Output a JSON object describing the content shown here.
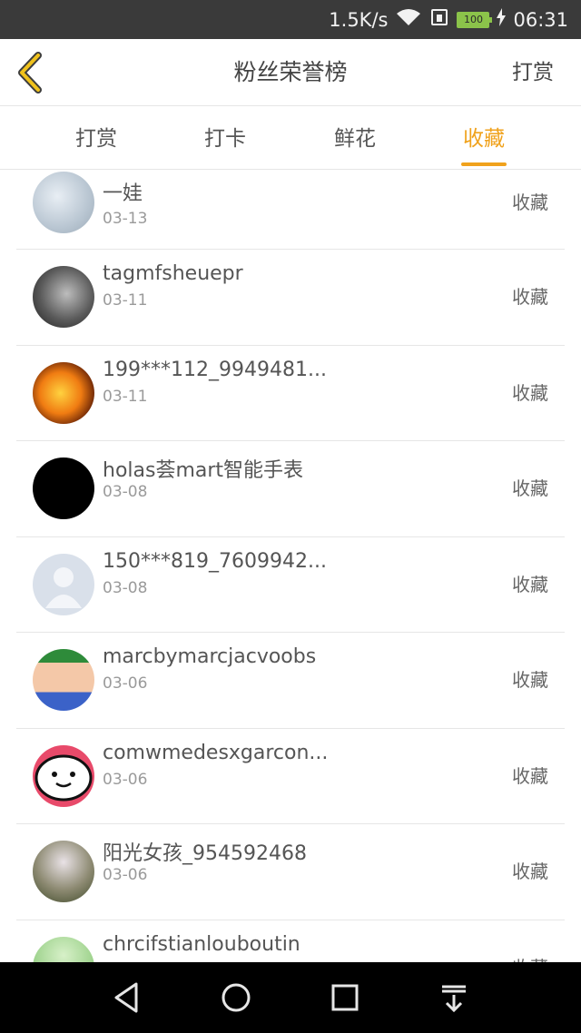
{
  "status": {
    "speed": "1.5K/s",
    "battery": "100",
    "time": "06:31"
  },
  "header": {
    "title": "粉丝荣誉榜",
    "action": "打赏"
  },
  "tabs": [
    {
      "label": "打赏",
      "active": false
    },
    {
      "label": "打卡",
      "active": false
    },
    {
      "label": "鲜花",
      "active": false
    },
    {
      "label": "收藏",
      "active": true
    }
  ],
  "list": [
    {
      "name": "一娃",
      "date": "03-13",
      "action": "收藏"
    },
    {
      "name": "tagmfsheuepr",
      "date": "03-11",
      "action": "收藏"
    },
    {
      "name": "199***112_9949481...",
      "date": "03-11",
      "action": "收藏"
    },
    {
      "name": "holas荟mart智能手表",
      "date": "03-08",
      "action": "收藏"
    },
    {
      "name": "150***819_7609942...",
      "date": "03-08",
      "action": "收藏"
    },
    {
      "name": "marcbymarcjacvoobs",
      "date": "03-06",
      "action": "收藏"
    },
    {
      "name": "comwmedesxgarcon...",
      "date": "03-06",
      "action": "收藏"
    },
    {
      "name": "阳光女孩_954592468",
      "date": "03-06",
      "action": "收藏"
    },
    {
      "name": "chrcifstianlouboutin",
      "date": "",
      "action": "收藏"
    }
  ],
  "colors": {
    "accent": "#f0a21c",
    "back_arrow": "#f0c21c"
  }
}
